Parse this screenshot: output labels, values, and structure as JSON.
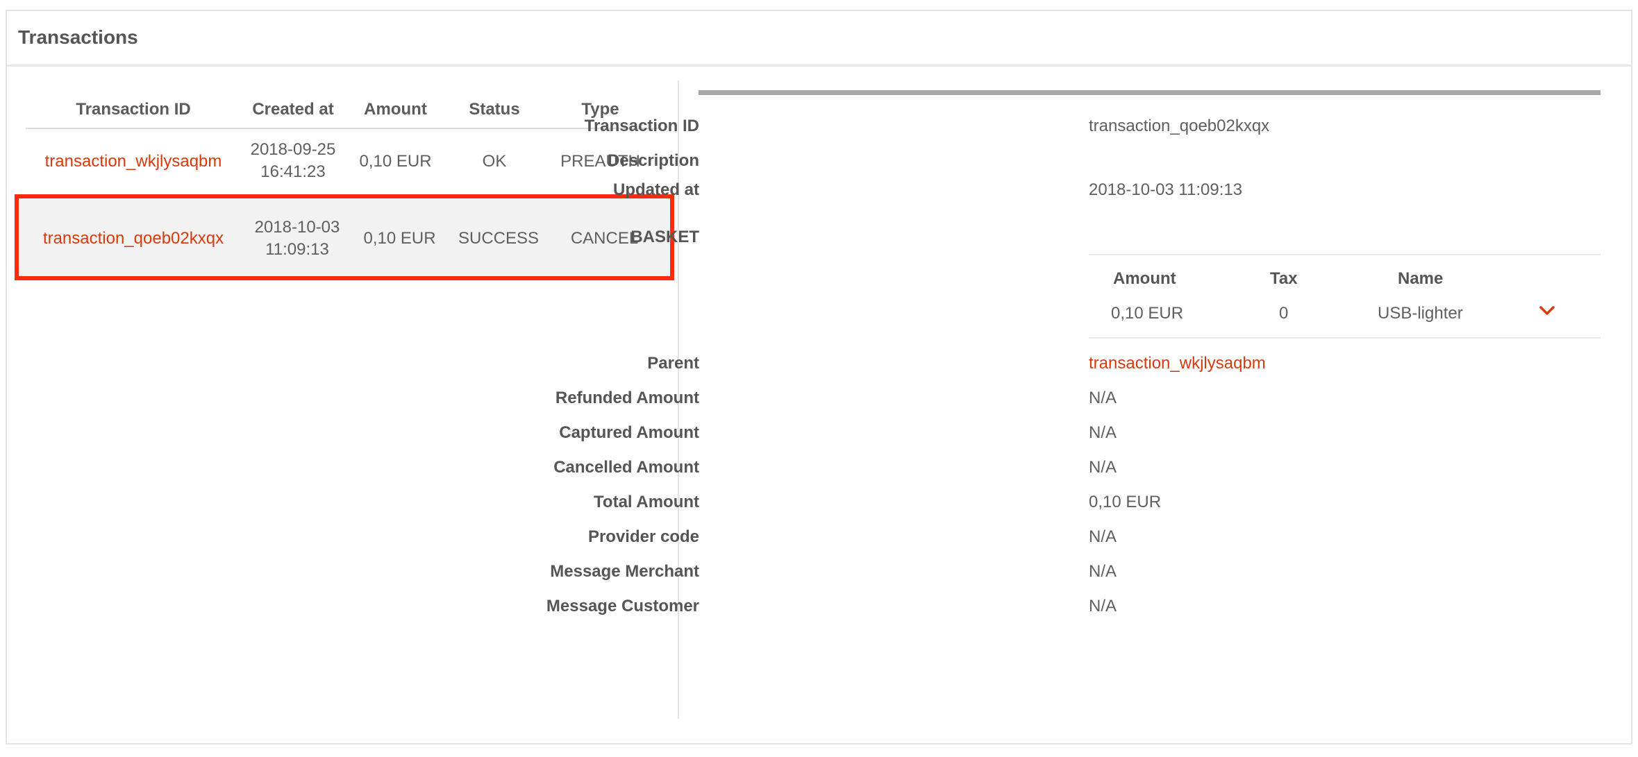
{
  "panel": {
    "title": "Transactions"
  },
  "list": {
    "headers": [
      "Transaction ID",
      "Created at",
      "Amount",
      "Status",
      "Type"
    ],
    "rows": [
      {
        "id": "transaction_wkjlysaqbm",
        "date": "2018-09-25",
        "time": "16:41:23",
        "amount": "0,10 EUR",
        "status": "OK",
        "type": "PREAUTH"
      },
      {
        "id": "transaction_qoeb02kxqx",
        "date": "2018-10-03",
        "time": "11:09:13",
        "amount": "0,10 EUR",
        "status": "SUCCESS",
        "type": "CANCEL"
      }
    ]
  },
  "detail": {
    "transaction_id_label": "Transaction ID",
    "transaction_id": "transaction_qoeb02kxqx",
    "description_label": "Description",
    "updated_at_label": "Updated at",
    "updated_at": "2018-10-03 11:09:13",
    "basket_label": "BASKET",
    "basket": {
      "headers": [
        "Amount",
        "Tax",
        "Name"
      ],
      "row": {
        "amount": "0,10 EUR",
        "tax": "0",
        "name": "USB-lighter"
      }
    },
    "parent_label": "Parent",
    "parent": "transaction_wkjlysaqbm",
    "refunded_label": "Refunded Amount",
    "refunded": "N/A",
    "captured_label": "Captured Amount",
    "captured": "N/A",
    "cancelled_label": "Cancelled Amount",
    "cancelled": "N/A",
    "total_label": "Total Amount",
    "total": "0,10 EUR",
    "provider_code_label": "Provider code",
    "provider_code": "N/A",
    "msg_merchant_label": "Message Merchant",
    "msg_merchant": "N/A",
    "msg_customer_label": "Message Customer",
    "msg_customer": "N/A"
  },
  "icons": {
    "expand": "chevron-down-icon"
  },
  "colors": {
    "link": "#d93a0c",
    "highlight": "#ff2b0f"
  }
}
